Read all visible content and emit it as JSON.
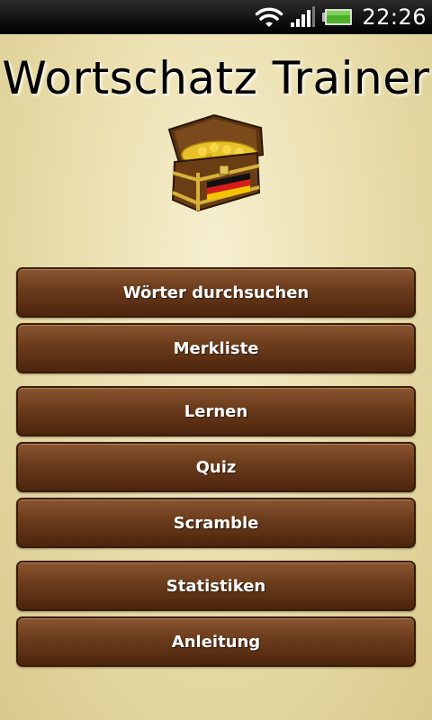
{
  "status_bar": {
    "time": "22:26",
    "icons": [
      "wifi-icon",
      "signal-icon",
      "battery-icon"
    ],
    "battery_color": "#4caf2a"
  },
  "app": {
    "title": "Wortschatz Trainer",
    "logo_icon": "treasure-chest-icon"
  },
  "menu": {
    "items": [
      {
        "label": "Wörter durchsuchen"
      },
      {
        "label": "Merkliste"
      },
      {
        "label": "Lernen"
      },
      {
        "label": "Quiz"
      },
      {
        "label": "Scramble"
      },
      {
        "label": "Statistiken"
      },
      {
        "label": "Anleitung"
      }
    ]
  },
  "colors": {
    "button_brown": "#6a3b1b",
    "background_parchment": "#eadfae"
  }
}
